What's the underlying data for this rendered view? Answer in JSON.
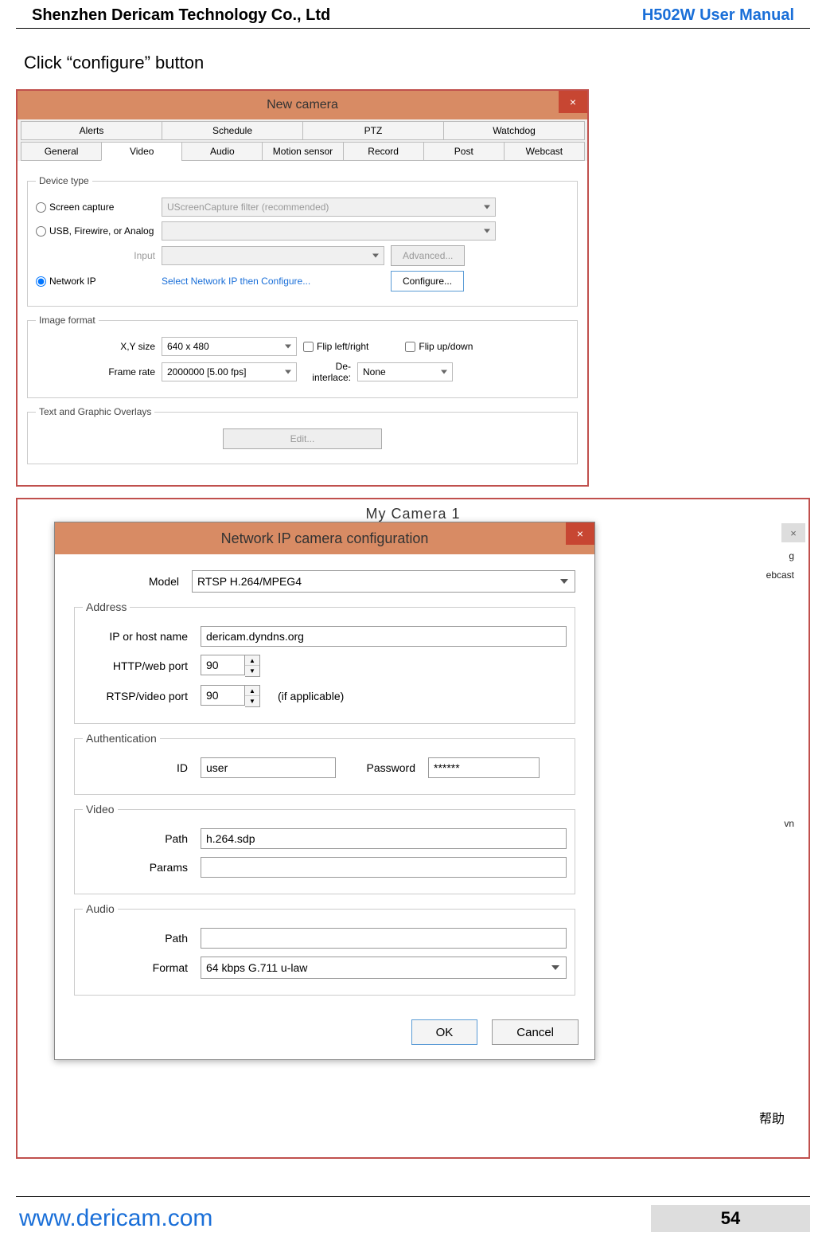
{
  "header": {
    "company": "Shenzhen Dericam Technology Co., Ltd",
    "manual": "H502W User Manual"
  },
  "instruction": "Click “configure” button",
  "fig1": {
    "title": "New camera",
    "close_glyph": "×",
    "tabs_row1": [
      "Alerts",
      "Schedule",
      "PTZ",
      "Watchdog"
    ],
    "tabs_row2": [
      "General",
      "Video",
      "Audio",
      "Motion sensor",
      "Record",
      "Post",
      "Webcast"
    ],
    "active_tab": "Video",
    "fs_device": {
      "legend": "Device type",
      "opt_screen": "Screen capture",
      "opt_usb": "USB, Firewire, or Analog",
      "opt_network": "Network IP",
      "screen_filter": "UScreenCapture filter (recommended)",
      "input_lbl": "Input",
      "advanced_btn": "Advanced...",
      "net_hint": "Select Network IP then Configure...",
      "configure_btn": "Configure..."
    },
    "fs_image": {
      "legend": "Image format",
      "xy_lbl": "X,Y size",
      "xy_val": "640 x 480",
      "frame_lbl": "Frame rate",
      "frame_val": "2000000 [5.00 fps]",
      "flip_lr": "Flip left/right",
      "flip_ud": "Flip up/down",
      "deint_lbl": "De-interlace:",
      "deint_val": "None"
    },
    "fs_text": {
      "legend": "Text and Graphic Overlays",
      "edit_btn": "Edit..."
    }
  },
  "fig2": {
    "bg_title": "My Camera 1",
    "bg_close": "×",
    "title": "Network IP camera configuration",
    "close_glyph": "×",
    "model_lbl": "Model",
    "model_val": "RTSP H.264/MPEG4",
    "address": {
      "legend": "Address",
      "ip_lbl": "IP or host name",
      "ip_val": "dericam.dyndns.org",
      "http_lbl": "HTTP/web port",
      "http_val": "90",
      "rtsp_lbl": "RTSP/video port",
      "rtsp_val": "90",
      "rtsp_note": "(if applicable)"
    },
    "auth": {
      "legend": "Authentication",
      "id_lbl": "ID",
      "id_val": "user",
      "pw_lbl": "Password",
      "pw_val": "******"
    },
    "video": {
      "legend": "Video",
      "path_lbl": "Path",
      "path_val": "h.264.sdp",
      "params_lbl": "Params",
      "params_val": ""
    },
    "audio": {
      "legend": "Audio",
      "path_lbl": "Path",
      "path_val": "",
      "format_lbl": "Format",
      "format_val": "64 kbps G.711 u-law"
    },
    "ok_btn": "OK",
    "cancel_btn": "Cancel",
    "bg_hints": {
      "g": "g",
      "ebcast": "ebcast",
      "vn": "vn",
      "help": "帮助"
    }
  },
  "footer": {
    "link": "www.dericam.com",
    "page": "54"
  }
}
